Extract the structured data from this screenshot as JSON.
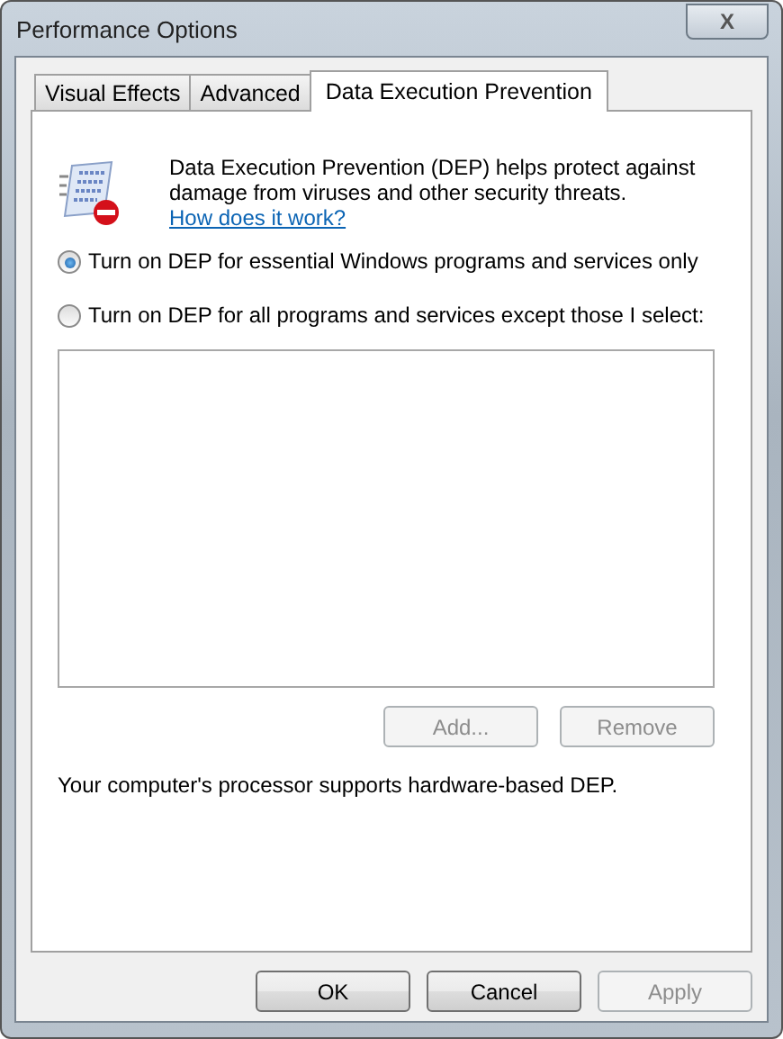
{
  "window": {
    "title": "Performance Options",
    "close": "X"
  },
  "tabs": [
    {
      "label": "Visual Effects",
      "selected": false
    },
    {
      "label": "Advanced",
      "selected": false
    },
    {
      "label": "Data Execution Prevention",
      "selected": true
    }
  ],
  "description": "Data Execution Prevention (DEP) helps protect against damage from viruses and other security threats.",
  "link": "How does it work?",
  "options": [
    {
      "label": "Turn on DEP for essential Windows programs and services only",
      "selected": true
    },
    {
      "label": "Turn on DEP for all programs and services except those I select:",
      "selected": false
    }
  ],
  "list_buttons": [
    {
      "label": "Add...",
      "disabled": true
    },
    {
      "label": "Remove",
      "disabled": true
    }
  ],
  "status": "Your computer's processor supports hardware-based DEP.",
  "buttons": [
    {
      "label": "OK",
      "disabled": false
    },
    {
      "label": "Cancel",
      "disabled": false
    },
    {
      "label": "Apply",
      "disabled": true
    }
  ]
}
